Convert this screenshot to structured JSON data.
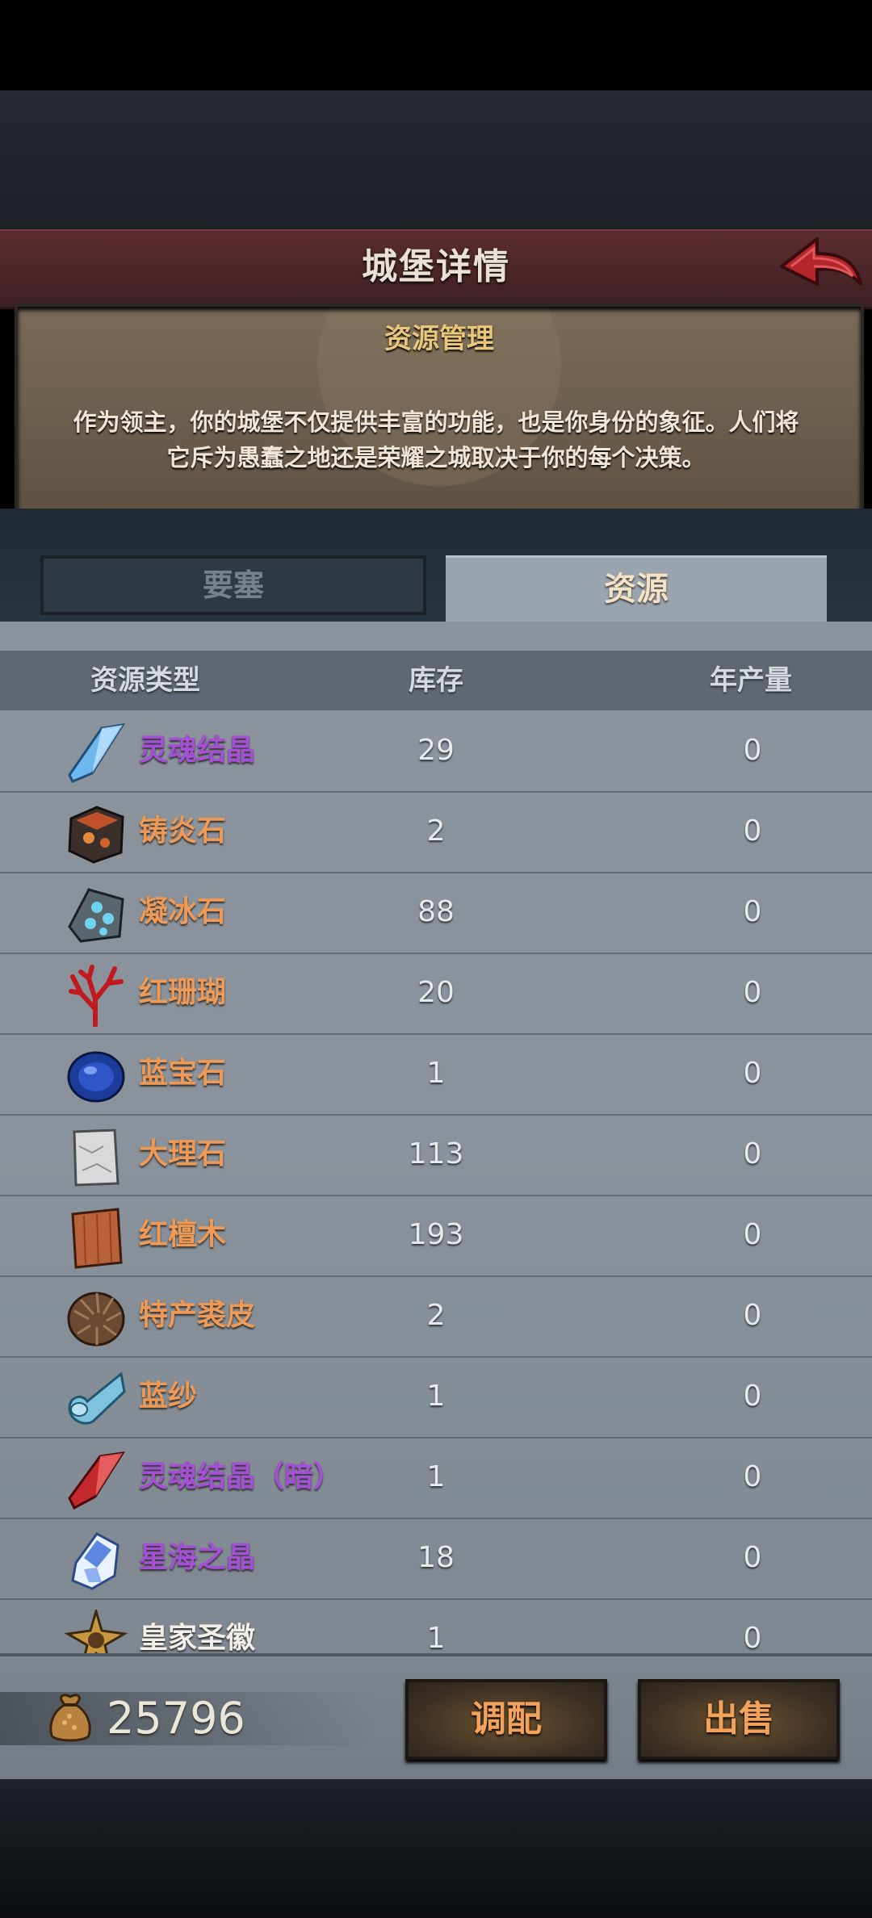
{
  "header": {
    "title": "城堡详情",
    "back_icon": "back-arrow-icon"
  },
  "intro": {
    "subtitle": "资源管理",
    "line1": "作为领主，你的城堡不仅提供丰富的功能，也是你身份的象征。人们将",
    "line2": "它斥为愚蠢之地还是荣耀之城取决于你的每个决策。"
  },
  "tabs": [
    {
      "label": "要塞",
      "active": false
    },
    {
      "label": "资源",
      "active": true
    }
  ],
  "table": {
    "columns": [
      "资源类型",
      "库存",
      "年产量"
    ],
    "rows": [
      {
        "name": "灵魂结晶",
        "stock": "29",
        "year": "0",
        "color": "#a54fd6",
        "icon": "blue-crystal-icon"
      },
      {
        "name": "铸炎石",
        "stock": "2",
        "year": "0",
        "color": "#ee9a56",
        "icon": "fire-ore-icon"
      },
      {
        "name": "凝冰石",
        "stock": "88",
        "year": "0",
        "color": "#ee9a56",
        "icon": "ice-stone-icon"
      },
      {
        "name": "红珊瑚",
        "stock": "20",
        "year": "0",
        "color": "#ee9a56",
        "icon": "red-coral-icon"
      },
      {
        "name": "蓝宝石",
        "stock": "1",
        "year": "0",
        "color": "#ee9a56",
        "icon": "sapphire-icon"
      },
      {
        "name": "大理石",
        "stock": "113",
        "year": "0",
        "color": "#ee9a56",
        "icon": "marble-icon"
      },
      {
        "name": "红檀木",
        "stock": "193",
        "year": "0",
        "color": "#ee9a56",
        "icon": "red-sandalwood-icon"
      },
      {
        "name": "特产裘皮",
        "stock": "2",
        "year": "0",
        "color": "#ee9a56",
        "icon": "fur-icon"
      },
      {
        "name": "蓝纱",
        "stock": "1",
        "year": "0",
        "color": "#ee9a56",
        "icon": "blue-silk-icon"
      },
      {
        "name": "灵魂结晶（暗）",
        "stock": "1",
        "year": "0",
        "color": "#a54fd6",
        "icon": "red-crystal-icon"
      },
      {
        "name": "星海之晶",
        "stock": "18",
        "year": "0",
        "color": "#a54fd6",
        "icon": "star-crystal-icon"
      },
      {
        "name": "皇家圣徽",
        "stock": "1",
        "year": "0",
        "color": "#f2efe8",
        "icon": "royal-emblem-icon"
      }
    ]
  },
  "footer": {
    "coin_icon": "money-bag-icon",
    "gold": "25796",
    "allocate_label": "调配",
    "sell_label": "出售"
  }
}
